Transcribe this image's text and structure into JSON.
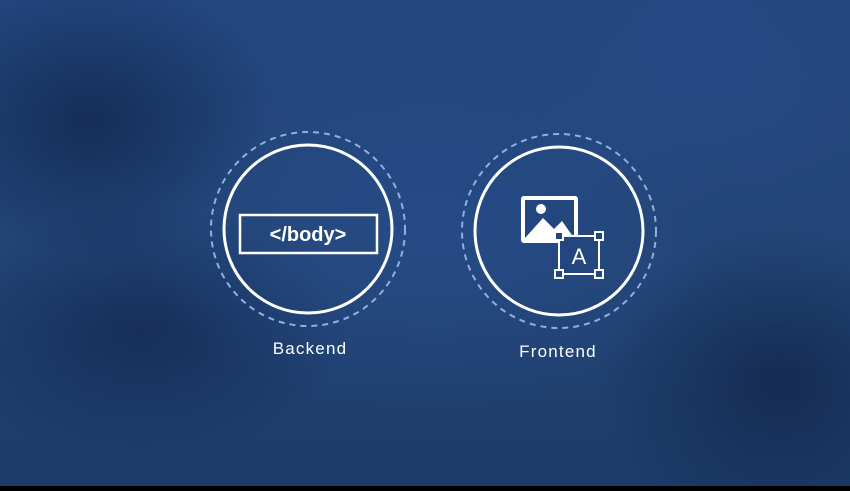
{
  "cards": [
    {
      "label": "Backend",
      "icon": "code-tag-icon",
      "code_text": "</body>"
    },
    {
      "label": "Frontend",
      "icon": "image-text-icon",
      "glyph": "A"
    }
  ],
  "colors": {
    "background": "#23467e",
    "stroke": "#ffffff",
    "dashed_ring": "#8fb0e0"
  }
}
